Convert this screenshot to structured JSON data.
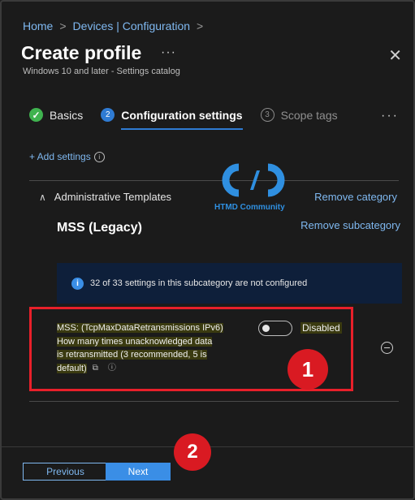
{
  "breadcrumb": {
    "home": "Home",
    "sep": ">",
    "devices": "Devices | Configuration",
    "sep2": ">"
  },
  "page": {
    "title": "Create profile",
    "more": "···",
    "close": "✕",
    "subtitle": "Windows 10 and later - Settings catalog"
  },
  "steps": [
    {
      "num": "✓",
      "label": "Basics",
      "state": "done"
    },
    {
      "num": "2",
      "label": "Configuration settings",
      "state": "active"
    },
    {
      "num": "3",
      "label": "Scope tags",
      "state": "idle"
    }
  ],
  "steps_more": "···",
  "add_settings": {
    "label": "+ Add settings",
    "info": "i"
  },
  "logo_text": "HTMD Community",
  "category": {
    "chevron": "∧",
    "name": "Administrative Templates",
    "remove_category": "Remove category",
    "subcategory": "MSS (Legacy)",
    "remove_subcategory": "Remove subcategory"
  },
  "banner": {
    "icon": "i",
    "text": "32 of 33 settings in this subcategory are not configured"
  },
  "setting": {
    "line1": "MSS: (TcpMaxDataRetransmissions IPv6)",
    "line2": "How many times unacknowledged data",
    "line3": "is retransmitted (3 recommended, 5 is",
    "line4": "default)",
    "copy_icon": "⧉",
    "info_icon": "ⓘ",
    "toggle_state": "Disabled"
  },
  "badges": {
    "one": "1",
    "two": "2"
  },
  "footer": {
    "previous": "Previous",
    "next": "Next"
  },
  "colors": {
    "accent": "#3a8ee6",
    "highlight": "#e8202a",
    "badge": "#d91a22"
  }
}
